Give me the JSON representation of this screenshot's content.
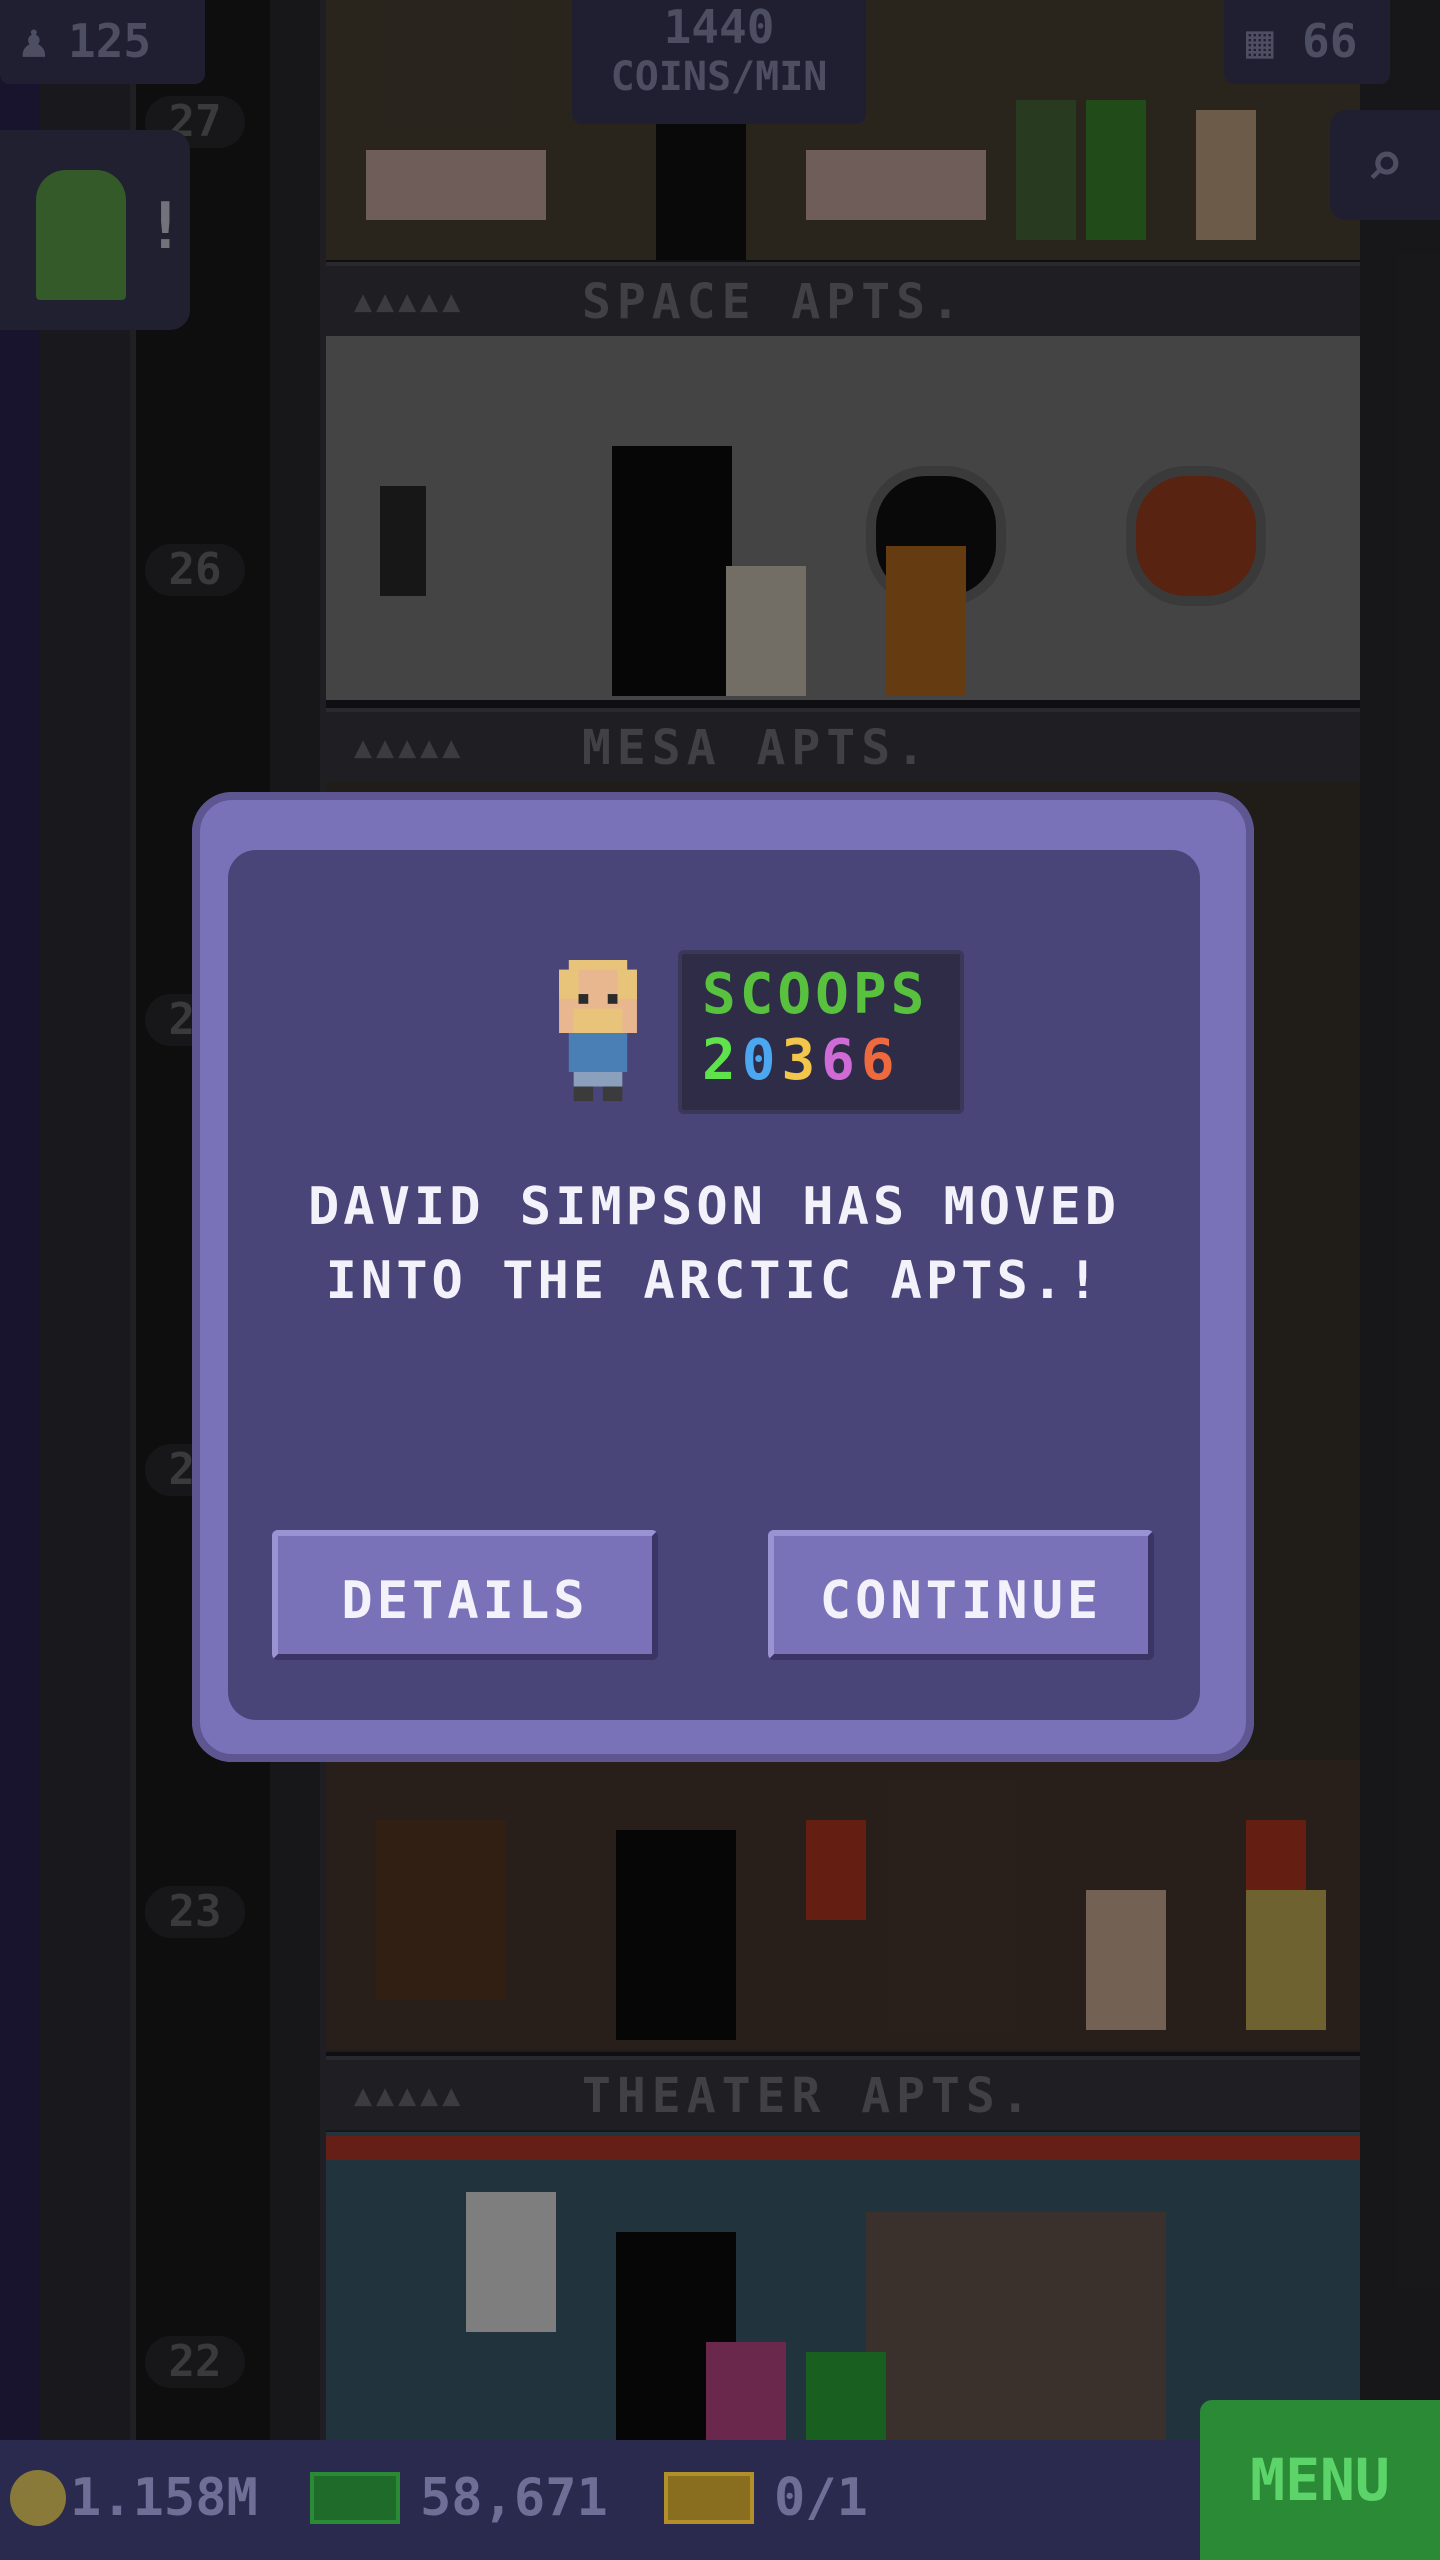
{
  "hud": {
    "top_left_count": "125",
    "coins_per_min_value": "1440",
    "coins_per_min_label": "COINS/MIN",
    "top_right_count": "66"
  },
  "floors": [
    {
      "number": "27"
    },
    {
      "number": "26"
    },
    {
      "number": "25"
    },
    {
      "number": "24"
    },
    {
      "number": "23"
    },
    {
      "number": "22"
    }
  ],
  "floor_labels": {
    "space": "SPACE APTS.",
    "mesa": "MESA APTS.",
    "theater": "THEATER APTS."
  },
  "dialog": {
    "score_title": "SCOOPS",
    "score_digits": [
      "2",
      "0",
      "3",
      "6",
      "6"
    ],
    "score_colors": [
      "#5fe24c",
      "#4aa7f0",
      "#f2c64a",
      "#d06ad6",
      "#ee6a3e"
    ],
    "message_line1": "DAVID SIMPSON HAS MOVED",
    "message_line2": "INTO THE ARCTIC APTS.!",
    "details_label": "DETAILS",
    "continue_label": "CONTINUE"
  },
  "bottom_bar": {
    "coins": "1.158M",
    "bux": "58,671",
    "tickets": "0/1",
    "menu_label": "MENU"
  }
}
